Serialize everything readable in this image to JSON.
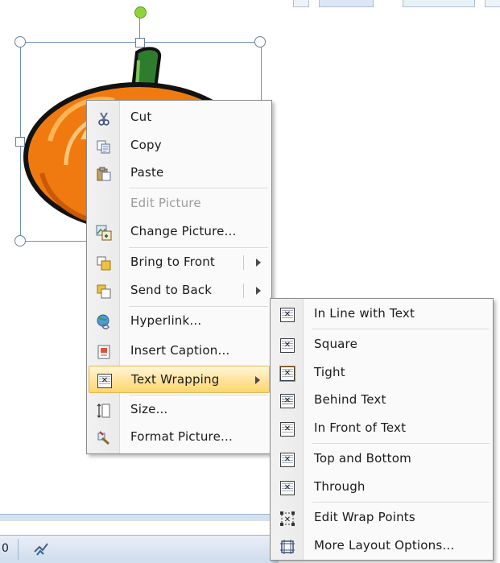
{
  "context_menu": {
    "items": [
      {
        "label": "Cut",
        "icon": "scissors-icon"
      },
      {
        "label": "Copy",
        "icon": "copy-icon"
      },
      {
        "label": "Paste",
        "icon": "paste-icon"
      },
      {
        "label": "Edit Picture",
        "icon": "none",
        "disabled": true
      },
      {
        "label": "Change Picture...",
        "icon": "change-picture-icon"
      },
      {
        "label": "Bring to Front",
        "icon": "bring-to-front-icon"
      },
      {
        "label": "Send to Back",
        "icon": "send-to-back-icon"
      },
      {
        "label": "Hyperlink...",
        "icon": "hyperlink-globe-icon"
      },
      {
        "label": "Insert Caption...",
        "icon": "insert-caption-icon"
      },
      {
        "label": "Text Wrapping",
        "icon": "text-wrapping-icon",
        "highlighted": true
      },
      {
        "label": "Size...",
        "icon": "size-icon"
      },
      {
        "label": "Format Picture...",
        "icon": "format-picture-icon"
      }
    ]
  },
  "submenu": {
    "items": [
      {
        "label": "In Line with Text",
        "icon": "wrap-inline-icon"
      },
      {
        "label": "Square",
        "icon": "wrap-square-icon"
      },
      {
        "label": "Tight",
        "icon": "wrap-tight-icon",
        "selected": true
      },
      {
        "label": "Behind Text",
        "icon": "wrap-behind-icon"
      },
      {
        "label": "In Front of Text",
        "icon": "wrap-front-icon"
      },
      {
        "label": "Top and Bottom",
        "icon": "wrap-top-bottom-icon"
      },
      {
        "label": "Through",
        "icon": "wrap-through-icon"
      },
      {
        "label": "Edit Wrap Points",
        "icon": "edit-wrap-points-icon"
      },
      {
        "label": "More Layout Options...",
        "icon": "layout-options-icon"
      }
    ]
  },
  "status_bar": {
    "page_fragment": "0",
    "proofing_icon": "spelling-check-icon"
  },
  "colors": {
    "highlight": "#ffe39b",
    "pumpkin": "#f07a10",
    "stem": "#2e7d2e",
    "rotate_handle": "#8ed43a"
  }
}
